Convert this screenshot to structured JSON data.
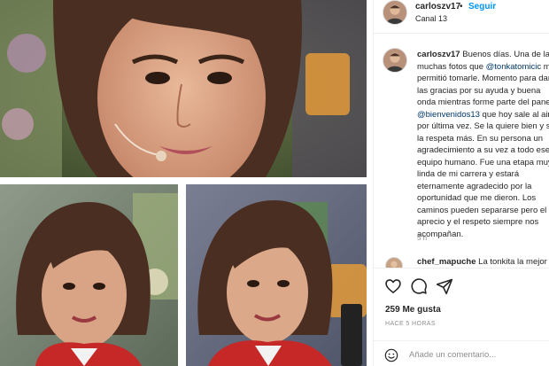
{
  "post": {
    "username": "carloszv17",
    "separator": "•",
    "follow_label": "Seguir",
    "location": "Canal 13"
  },
  "caption": {
    "username": "carloszv17",
    "part1": " Buenos días. Una de las muchas fotos que ",
    "mention1": "@tonkatomicic",
    "part2": " me permitió tomarle. Momento para darle las gracias por su ayuda y buena onda mientras forme parte del panel ",
    "mention2": "@bienvenidos13",
    "part3": " que hoy sale al aire por última vez. Se la quiere bien y se la respeta más. En su persona un agradecimiento a su vez a todo ese equipo humano. Fue una etapa muy linda de mi carrera y estará eternamente agradecido por la oportunidad que me dieron. Los caminos pueden separarse pero el aprecio y el respeto siempre nos acompañan.",
    "time": "5 h"
  },
  "comments": [
    {
      "username": "chef_mapuche",
      "text": "La tonkita la mejor"
    }
  ],
  "likes_text": "259 Me gusta",
  "posted_ago": "HACE 5 HORAS",
  "add_comment_placeholder": "Añade un comentario...",
  "icons": {
    "like": "heart-outline-icon",
    "comment": "speech-bubble-icon",
    "share": "paper-plane-icon",
    "emoji": "smiley-icon"
  },
  "colors": {
    "follow": "#0095f6",
    "mention": "#00376b",
    "muted": "#8e8e8e",
    "border": "#efefef"
  }
}
